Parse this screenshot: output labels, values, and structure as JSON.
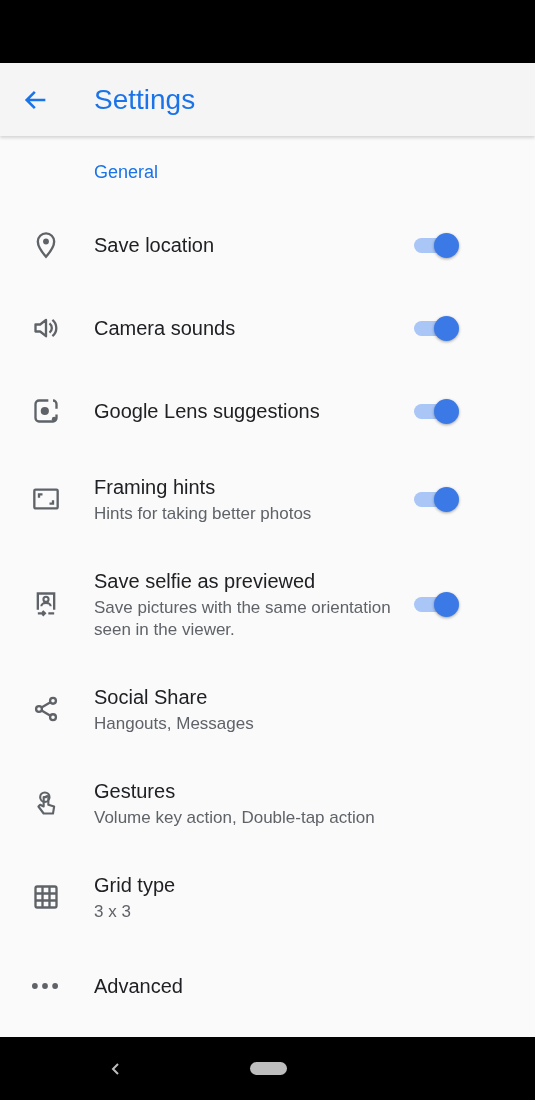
{
  "app_bar": {
    "title": "Settings"
  },
  "section": {
    "title": "General"
  },
  "settings": [
    {
      "title": "Save location",
      "kind": "toggle",
      "on": true
    },
    {
      "title": "Camera sounds",
      "kind": "toggle",
      "on": true
    },
    {
      "title": "Google Lens suggestions",
      "kind": "toggle",
      "on": true
    },
    {
      "title": "Framing hints",
      "subtitle": "Hints for taking better photos",
      "kind": "toggle",
      "on": true
    },
    {
      "title": "Save selfie as previewed",
      "subtitle": "Save pictures with the same orientation seen in the viewer.",
      "kind": "toggle",
      "on": true
    },
    {
      "title": "Social Share",
      "subtitle": "Hangouts, Messages",
      "kind": "link"
    },
    {
      "title": "Gestures",
      "subtitle": "Volume key action, Double-tap action",
      "kind": "link"
    },
    {
      "title": "Grid type",
      "subtitle": "3 x 3",
      "kind": "link"
    },
    {
      "title": "Advanced",
      "kind": "link"
    }
  ]
}
